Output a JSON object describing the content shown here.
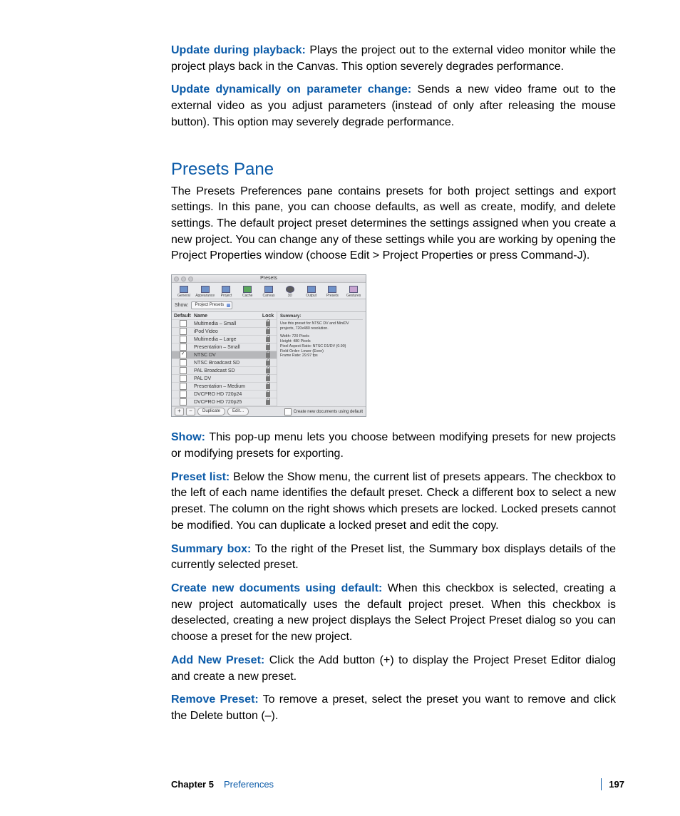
{
  "paragraphs": {
    "p1_term": "Update during playback:",
    "p1_body": " Plays the project out to the external video monitor while the project plays back in the Canvas. This option severely degrades performance.",
    "p2_term": "Update dynamically on parameter change:",
    "p2_body": "  Sends a new video frame out to the external video as you adjust parameters (instead of only after releasing the mouse button). This option may severely degrade performance.",
    "heading": "Presets Pane",
    "intro": "The Presets Preferences pane contains presets for both project settings and export settings. In this pane, you can choose defaults, as well as create, modify, and delete settings. The default project preset determines the settings assigned when you create a new project. You can change any of these settings while you are working by opening the Project Properties window (choose Edit > Project Properties or press Command-J).",
    "s1_term": "Show:",
    "s1_body": " This pop-up menu lets you choose between modifying presets for new projects or modifying presets for exporting.",
    "s2_term": "Preset list:",
    "s2_body": " Below the Show menu, the current list of presets appears. The checkbox to the left of each name identifies the default preset. Check a different box to select a new preset. The column on the right shows which presets are locked. Locked presets cannot be modified. You can duplicate a locked preset and edit the copy.",
    "s3_term": "Summary box:",
    "s3_body": " To the right of the Preset list, the Summary box displays details of the currently selected preset.",
    "s4_term": "Create new documents using default:",
    "s4_body": "  When this checkbox is selected, creating a new project automatically uses the default project preset. When this checkbox is deselected, creating a new project displays the Select Project Preset dialog so you can choose a preset for the new project.",
    "s5_term": "Add New Preset:",
    "s5_body": "  Click the Add button (+) to display the Project Preset Editor dialog and create a new preset.",
    "s6_term": "Remove Preset:",
    "s6_body": "  To remove a preset, select the preset you want to remove and click the Delete button (–)."
  },
  "figure": {
    "title": "Presets",
    "tabs": [
      "General",
      "Appearance",
      "Project",
      "Cache",
      "Canvas",
      "3D",
      "Output",
      "Presets",
      "Gestures"
    ],
    "show_label": "Show:",
    "show_value": "Project Presets",
    "columns": {
      "default": "Default",
      "name": "Name",
      "lock": "Lock"
    },
    "rows": [
      {
        "default": false,
        "name": "Multimedia – Small",
        "locked": true,
        "selected": false
      },
      {
        "default": false,
        "name": "iPod Video",
        "locked": true,
        "selected": false
      },
      {
        "default": false,
        "name": "Multimedia – Large",
        "locked": true,
        "selected": false
      },
      {
        "default": false,
        "name": "Presentation – Small",
        "locked": true,
        "selected": false
      },
      {
        "default": true,
        "name": "NTSC DV",
        "locked": true,
        "selected": true
      },
      {
        "default": false,
        "name": "NTSC Broadcast SD",
        "locked": true,
        "selected": false
      },
      {
        "default": false,
        "name": "PAL Broadcast SD",
        "locked": true,
        "selected": false
      },
      {
        "default": false,
        "name": "PAL DV",
        "locked": true,
        "selected": false
      },
      {
        "default": false,
        "name": "Presentation – Medium",
        "locked": true,
        "selected": false
      },
      {
        "default": false,
        "name": "DVCPRO HD 720p24",
        "locked": true,
        "selected": false
      },
      {
        "default": false,
        "name": "DVCPRO HD 720p25",
        "locked": true,
        "selected": false
      }
    ],
    "summary_head": "Summary:",
    "summary_lines": [
      "Use this preset for NTSC DV and MiniDV projects, 720x480 resolution.",
      "",
      "Width: 720 Pixels",
      "Height: 480 Pixels",
      "Pixel Aspect Ratio: NTSC D1/DV (0.90)",
      "Field Order: Lower (Even)",
      "Frame Rate: 29.97 fps"
    ],
    "btn_add": "+",
    "btn_remove": "−",
    "btn_duplicate": "Duplicate",
    "btn_edit": "Edit…",
    "footer_checkbox": "Create new documents using default"
  },
  "footer": {
    "chapter": "Chapter 5",
    "chapter_name": "Preferences",
    "page_number": "197"
  }
}
